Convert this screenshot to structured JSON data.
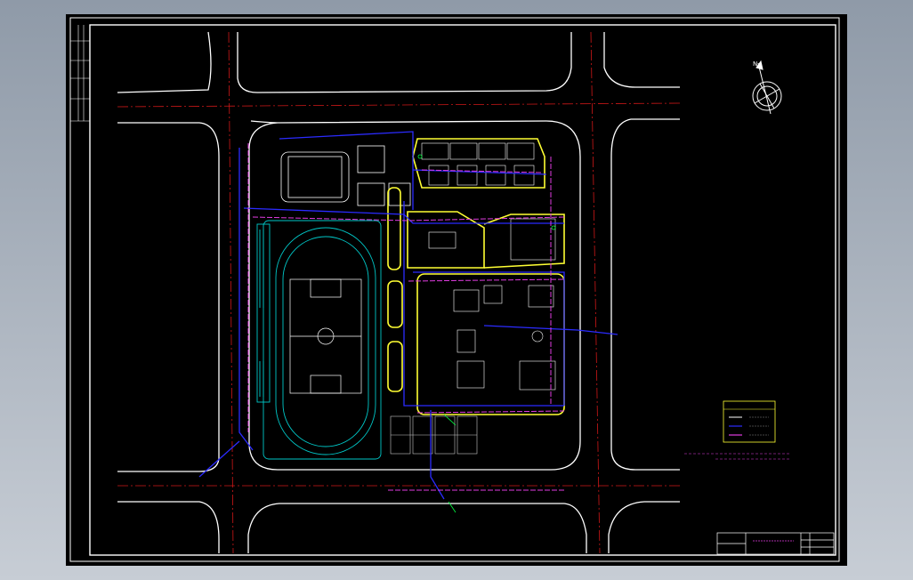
{
  "drawing": {
    "background": "#000000",
    "frame_color": "#ffffff",
    "road_color": "#ffffff",
    "centerline_color": "#d01818",
    "water_pipe_color": "#2b2bff",
    "drain_pipe_color": "#e03ce0",
    "building_color": "#ffff33",
    "site_color": "#00c8c8",
    "fixture_color": "#00ff40"
  },
  "legend": {
    "title": "",
    "items": [
      {
        "color": "#ffffff",
        "text": ""
      },
      {
        "color": "#2b2bff",
        "text": ""
      },
      {
        "color": "#e03ce0",
        "text": ""
      }
    ]
  },
  "title_block": {
    "drawing_title": "",
    "scale": "",
    "sheet": ""
  },
  "north_arrow": {
    "label": "N"
  }
}
